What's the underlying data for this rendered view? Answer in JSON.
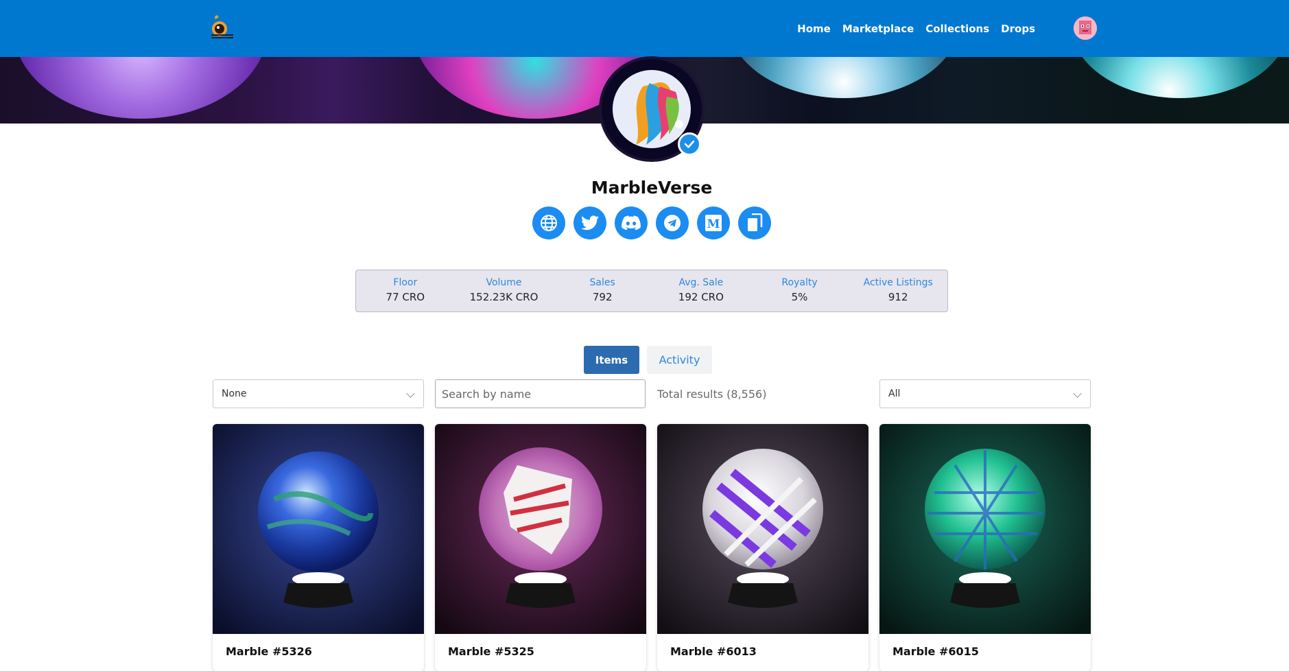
{
  "nav": {
    "links": [
      "Home",
      "Marketplace",
      "Collections",
      "Drops"
    ]
  },
  "collection": {
    "title": "MarbleVerse",
    "socials": [
      "globe-icon",
      "twitter-icon",
      "discord-icon",
      "telegram-icon",
      "medium-icon",
      "copy-icon"
    ]
  },
  "stats": [
    {
      "label": "Floor",
      "value": "77 CRO"
    },
    {
      "label": "Volume",
      "value": "152.23K CRO"
    },
    {
      "label": "Sales",
      "value": "792"
    },
    {
      "label": "Avg. Sale",
      "value": "192 CRO"
    },
    {
      "label": "Royalty",
      "value": "5%"
    },
    {
      "label": "Active Listings",
      "value": "912"
    }
  ],
  "tabs": {
    "items": "Items",
    "activity": "Activity"
  },
  "filters": {
    "sort_value": "None",
    "search_placeholder": "Search by name",
    "total_results": "Total results (8,556)",
    "status_value": "All"
  },
  "cards": [
    {
      "name": "Marble #5326"
    },
    {
      "name": "Marble #5325"
    },
    {
      "name": "Marble #6013"
    },
    {
      "name": "Marble #6015"
    }
  ],
  "colors": {
    "navbar": "#0078d0",
    "accent": "#1b8cf2",
    "tab_active": "#2d6bb0"
  }
}
